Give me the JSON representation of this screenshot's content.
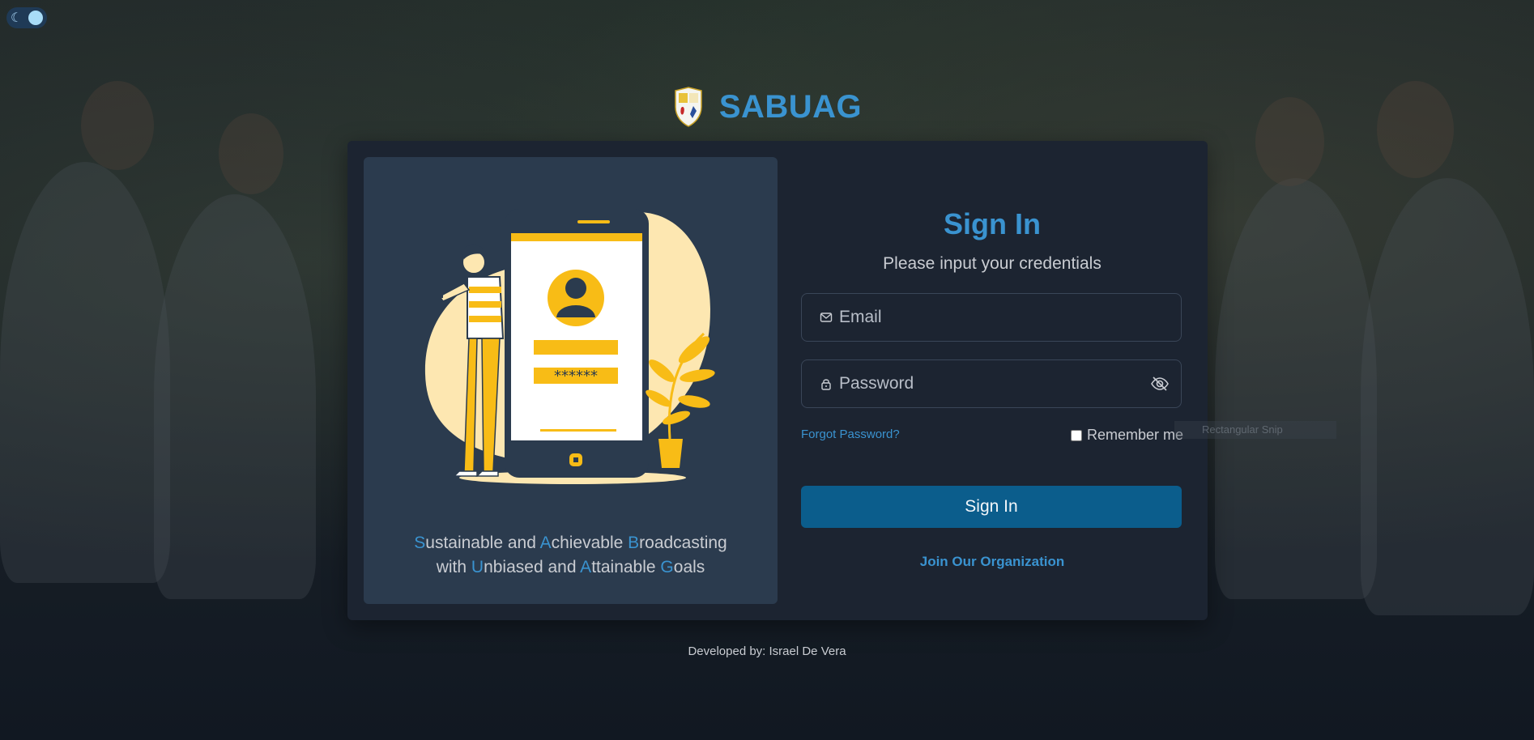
{
  "app": {
    "brand_name": "SABUAG"
  },
  "theme_toggle": {
    "icon": "moon-icon",
    "mode": "dark"
  },
  "left_panel": {
    "illustration": {
      "password_mask": "******"
    },
    "tagline": [
      {
        "hl": "S",
        "text": "ustainable and "
      },
      {
        "hl": "A",
        "text": "chievable "
      },
      {
        "hl": "B",
        "text": "roadcasting"
      },
      {
        "hl": "U",
        "text": "nbiased and ",
        "prefix": "with "
      },
      {
        "hl": "A",
        "text": "ttainable "
      },
      {
        "hl": "G",
        "text": "oals"
      }
    ]
  },
  "form": {
    "title": "Sign In",
    "subtitle": "Please input your credentials",
    "email_placeholder": "Email",
    "password_placeholder": "Password",
    "forgot_password": "Forgot Password?",
    "remember_me": "Remember me",
    "remember_checked": false,
    "submit_label": "Sign In",
    "join_link": "Join Our Organization"
  },
  "ghost_tooltip": "Rectangular Snip",
  "footer": {
    "credit": "Developed by: Israel De Vera"
  },
  "colors": {
    "accent": "#3a93d0",
    "button": "#0b5d8c",
    "card": "#1c2431",
    "panel": "#2b3b4e",
    "illustration_yellow": "#f8bc16",
    "illustration_blob": "#fde7b1"
  }
}
